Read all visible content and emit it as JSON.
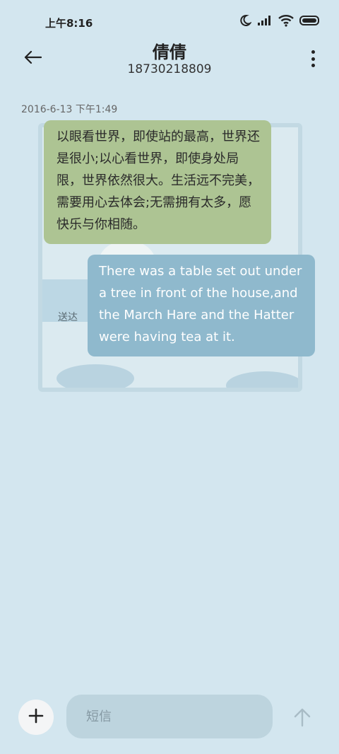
{
  "status_bar": {
    "time": "上午8:16",
    "icons": [
      "moon-icon",
      "signal-icon",
      "wifi-icon",
      "battery-icon"
    ]
  },
  "header": {
    "contact_name": "倩倩",
    "contact_number": "18730218809",
    "back_icon": "back-arrow-icon",
    "more_icon": "more-vertical-icon"
  },
  "conversation": {
    "timestamp": "2016-6-13 下午1:49",
    "messages": [
      {
        "direction": "incoming",
        "text": "以眼看世界，即使站的最高，世界还是很小;以心看世界，即使身处局限，世界依然很大。生活远不完美，需要用心去体会;无需拥有太多，愿快乐与你相随。"
      },
      {
        "direction": "outgoing",
        "text": "There was a table set out under a tree in front of the house,and the March Hare and the Hatter were having tea at it.",
        "status": "送达"
      }
    ]
  },
  "composer": {
    "add_icon": "plus-icon",
    "placeholder": "短信",
    "value": "",
    "send_icon": "send-arrow-icon"
  },
  "colors": {
    "background": "#d3e6ef",
    "incoming_bubble": "#adc493",
    "outgoing_bubble": "#8fb9cd",
    "input_box": "#bdd4de"
  }
}
